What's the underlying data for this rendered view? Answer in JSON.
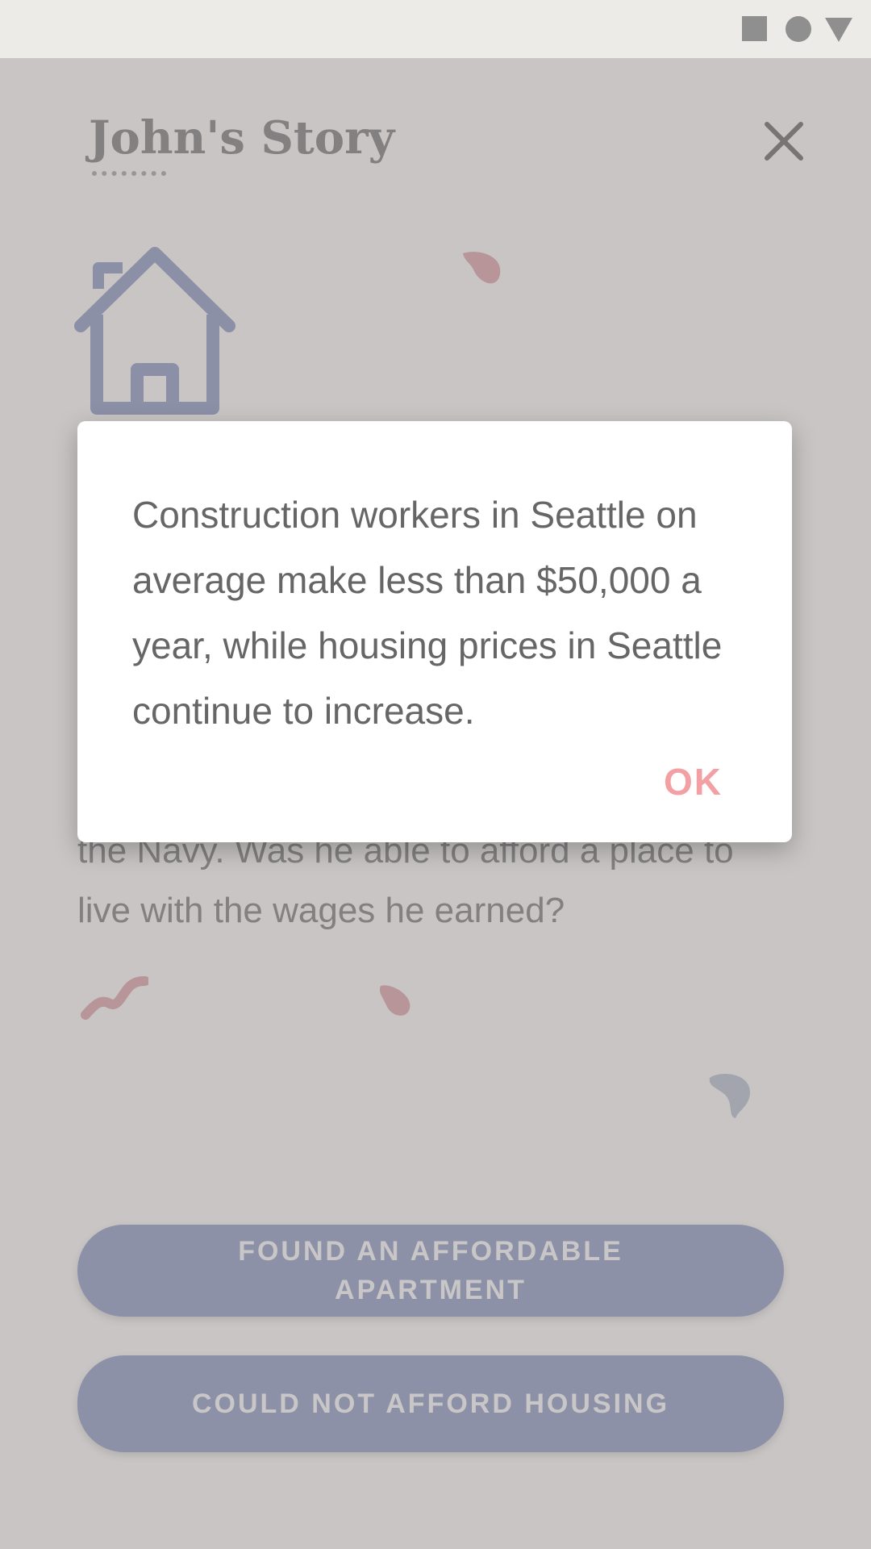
{
  "status_bar": {
    "icons": [
      "stop-square-icon",
      "home-circle-icon",
      "back-triangle-icon"
    ]
  },
  "page": {
    "title": "John's Story",
    "body_visible": "the Navy. Was he able to afford a place to live with the wages he earned?",
    "choices": [
      {
        "label": "FOUND AN AFFORDABLE APARTMENT"
      },
      {
        "label": "COULD NOT AFFORD HOUSING"
      }
    ],
    "icons": [
      "close-icon",
      "house-icon"
    ]
  },
  "dialog": {
    "message": "Construction workers in Seattle on average make less than $50,000 a year, while housing prices in Seattle continue to increase.",
    "ok_label": "OK"
  },
  "colors": {
    "accent_pink": "#f2a0a3",
    "button_blue": "#aab2d0",
    "text_gray": "#666666"
  }
}
